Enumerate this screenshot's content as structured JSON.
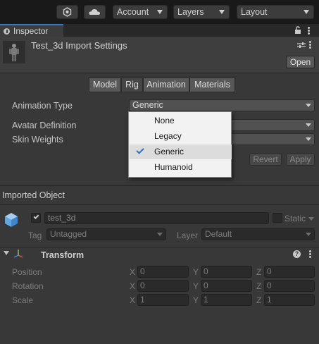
{
  "toolbar": {
    "account_label": "Account",
    "layers_label": "Layers",
    "layout_label": "Layout"
  },
  "inspector": {
    "tab_label": "Inspector",
    "title": "Test_3d Import Settings",
    "open_label": "Open"
  },
  "sub_tabs": [
    {
      "label": "Model"
    },
    {
      "label": "Rig"
    },
    {
      "label": "Animation"
    },
    {
      "label": "Materials"
    }
  ],
  "rig": {
    "animation_type_label": "Animation Type",
    "animation_type_value": "Generic",
    "avatar_definition_label": "Avatar Definition",
    "skin_weights_label": "Skin Weights",
    "revert_label": "Revert",
    "apply_label": "Apply"
  },
  "popup": {
    "items": [
      {
        "label": "None",
        "selected": false
      },
      {
        "label": "Legacy",
        "selected": false
      },
      {
        "label": "Generic",
        "selected": true
      },
      {
        "label": "Humanoid",
        "selected": false
      }
    ]
  },
  "imported_object": {
    "section_label": "Imported Object",
    "name": "test_3d",
    "static_label": "Static",
    "tag_label": "Tag",
    "tag_value": "Untagged",
    "layer_label": "Layer",
    "layer_value": "Default"
  },
  "transform": {
    "title": "Transform",
    "position_label": "Position",
    "rotation_label": "Rotation",
    "scale_label": "Scale",
    "x_label": "X",
    "y_label": "Y",
    "z_label": "Z",
    "position": {
      "x": "0",
      "y": "0",
      "z": "0"
    },
    "rotation": {
      "x": "0",
      "y": "0",
      "z": "0"
    },
    "scale": {
      "x": "1",
      "y": "1",
      "z": "1"
    }
  }
}
